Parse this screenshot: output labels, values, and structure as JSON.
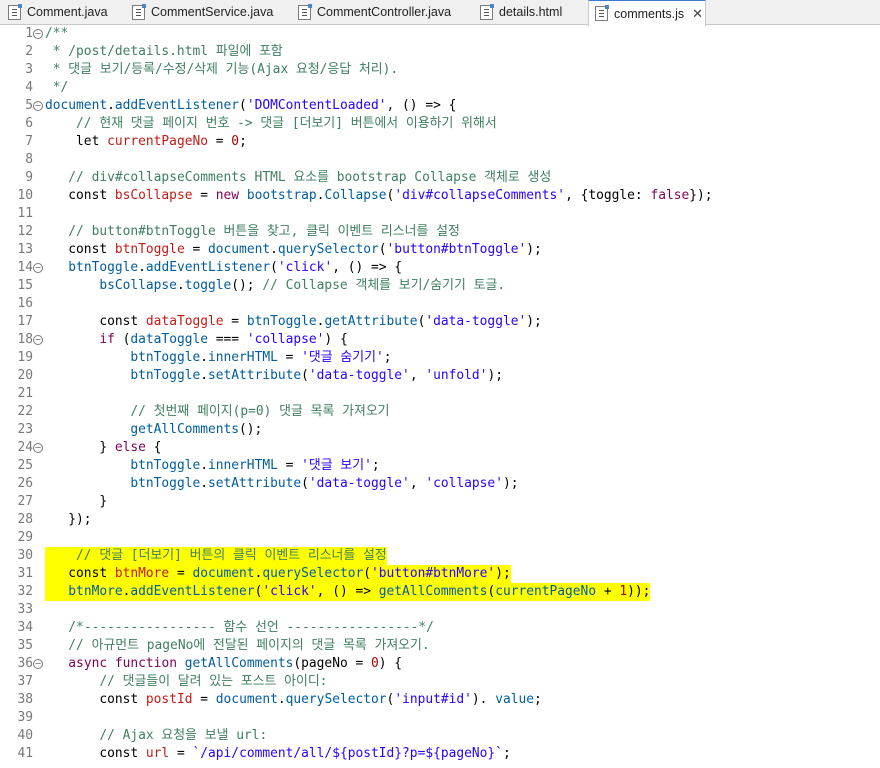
{
  "tabs": [
    {
      "label": "Comment.java",
      "icon": "java-file-icon"
    },
    {
      "label": "CommentService.java",
      "icon": "java-file-icon"
    },
    {
      "label": "CommentController.java",
      "icon": "java-file-icon"
    },
    {
      "label": "details.html",
      "icon": "html-file-icon"
    },
    {
      "label": "comments.js",
      "icon": "js-file-icon",
      "active": true,
      "close": "✕"
    }
  ],
  "colors": {
    "highlight": "#ffff00",
    "comment": "#3f7f5f",
    "string": "#2a00ff",
    "accent": "#3d7acc"
  },
  "lines": [
    {
      "n": "1",
      "fold": true,
      "t": [
        [
          "cm",
          "/**"
        ]
      ]
    },
    {
      "n": "2",
      "t": [
        [
          "cm",
          " * /post/details.html 파일에 포함"
        ]
      ]
    },
    {
      "n": "3",
      "t": [
        [
          "cm",
          " * 댓글 보기/등록/수정/삭제 기능(Ajax 요청/응답 처리)."
        ]
      ]
    },
    {
      "n": "4",
      "t": [
        [
          "cm",
          " */"
        ]
      ]
    },
    {
      "n": "5",
      "fold": true,
      "t": [
        [
          "pr",
          "document"
        ],
        [
          "tx",
          "."
        ],
        [
          "fn",
          "addEventListener"
        ],
        [
          "tx",
          "("
        ],
        [
          "st",
          "'DOMContentLoaded'"
        ],
        [
          "tx",
          ", () => {"
        ]
      ]
    },
    {
      "n": "6",
      "t": [
        [
          "tx",
          "    "
        ],
        [
          "cm",
          "// 현재 댓글 페이지 번호 -> 댓글 [더보기] 버튼에서 이용하기 위해서"
        ]
      ]
    },
    {
      "n": "7",
      "t": [
        [
          "tx",
          "    let "
        ],
        [
          "va",
          "currentPageNo"
        ],
        [
          "tx",
          " = "
        ],
        [
          "num",
          "0"
        ],
        [
          "tx",
          ";"
        ]
      ]
    },
    {
      "n": "8",
      "t": []
    },
    {
      "n": "9",
      "t": [
        [
          "tx",
          "   "
        ],
        [
          "cm",
          "// div#collapseComments HTML 요소를 bootstrap Collapse 객체로 생성"
        ]
      ]
    },
    {
      "n": "10",
      "t": [
        [
          "tx",
          "   const "
        ],
        [
          "va",
          "bsCollapse"
        ],
        [
          "tx",
          " = "
        ],
        [
          "bo",
          "new"
        ],
        [
          "tx",
          " "
        ],
        [
          "pr",
          "bootstrap"
        ],
        [
          "tx",
          "."
        ],
        [
          "fn",
          "Collapse"
        ],
        [
          "tx",
          "("
        ],
        [
          "st",
          "'div#collapseComments'"
        ],
        [
          "tx",
          ", {toggle: "
        ],
        [
          "bo",
          "false"
        ],
        [
          "tx",
          "});"
        ]
      ]
    },
    {
      "n": "11",
      "t": []
    },
    {
      "n": "12",
      "t": [
        [
          "tx",
          "   "
        ],
        [
          "cm",
          "// button#btnToggle 버튼을 찾고, 클릭 이벤트 리스너를 설정"
        ]
      ]
    },
    {
      "n": "13",
      "t": [
        [
          "tx",
          "   const "
        ],
        [
          "va",
          "btnToggle"
        ],
        [
          "tx",
          " = "
        ],
        [
          "pr",
          "document"
        ],
        [
          "tx",
          "."
        ],
        [
          "fn",
          "querySelector"
        ],
        [
          "tx",
          "("
        ],
        [
          "st",
          "'button#btnToggle'"
        ],
        [
          "tx",
          ");"
        ]
      ]
    },
    {
      "n": "14",
      "fold": true,
      "t": [
        [
          "tx",
          "   "
        ],
        [
          "pr",
          "btnToggle"
        ],
        [
          "tx",
          "."
        ],
        [
          "fn",
          "addEventListener"
        ],
        [
          "tx",
          "("
        ],
        [
          "st",
          "'click'"
        ],
        [
          "tx",
          ", () => {"
        ]
      ]
    },
    {
      "n": "15",
      "t": [
        [
          "tx",
          "       "
        ],
        [
          "pr",
          "bsCollapse"
        ],
        [
          "tx",
          "."
        ],
        [
          "fn",
          "toggle"
        ],
        [
          "tx",
          "(); "
        ],
        [
          "cm",
          "// Collapse 객체를 보기/숨기기 토글."
        ]
      ]
    },
    {
      "n": "16",
      "t": []
    },
    {
      "n": "17",
      "t": [
        [
          "tx",
          "       const "
        ],
        [
          "va",
          "dataToggle"
        ],
        [
          "tx",
          " = "
        ],
        [
          "pr",
          "btnToggle"
        ],
        [
          "tx",
          "."
        ],
        [
          "fn",
          "getAttribute"
        ],
        [
          "tx",
          "("
        ],
        [
          "st",
          "'data-toggle'"
        ],
        [
          "tx",
          ");"
        ]
      ]
    },
    {
      "n": "18",
      "fold": true,
      "t": [
        [
          "tx",
          "       "
        ],
        [
          "bo",
          "if"
        ],
        [
          "tx",
          " ("
        ],
        [
          "pr",
          "dataToggle"
        ],
        [
          "tx",
          " === "
        ],
        [
          "st",
          "'collapse'"
        ],
        [
          "tx",
          ") {"
        ]
      ]
    },
    {
      "n": "19",
      "t": [
        [
          "tx",
          "           "
        ],
        [
          "pr",
          "btnToggle"
        ],
        [
          "tx",
          "."
        ],
        [
          "pr",
          "innerHTML"
        ],
        [
          "tx",
          " = "
        ],
        [
          "st",
          "'댓글 숨기기'"
        ],
        [
          "tx",
          ";"
        ]
      ]
    },
    {
      "n": "20",
      "t": [
        [
          "tx",
          "           "
        ],
        [
          "pr",
          "btnToggle"
        ],
        [
          "tx",
          "."
        ],
        [
          "fn",
          "setAttribute"
        ],
        [
          "tx",
          "("
        ],
        [
          "st",
          "'data-toggle'"
        ],
        [
          "tx",
          ", "
        ],
        [
          "st",
          "'unfold'"
        ],
        [
          "tx",
          ");"
        ]
      ]
    },
    {
      "n": "21",
      "t": []
    },
    {
      "n": "22",
      "t": [
        [
          "tx",
          "           "
        ],
        [
          "cm",
          "// 첫번째 페이지(p=0) 댓글 목록 가져오기"
        ]
      ]
    },
    {
      "n": "23",
      "t": [
        [
          "tx",
          "           "
        ],
        [
          "fn",
          "getAllComments"
        ],
        [
          "tx",
          "();"
        ]
      ]
    },
    {
      "n": "24",
      "fold": true,
      "t": [
        [
          "tx",
          "       } "
        ],
        [
          "bo",
          "else"
        ],
        [
          "tx",
          " {"
        ]
      ]
    },
    {
      "n": "25",
      "t": [
        [
          "tx",
          "           "
        ],
        [
          "pr",
          "btnToggle"
        ],
        [
          "tx",
          "."
        ],
        [
          "pr",
          "innerHTML"
        ],
        [
          "tx",
          " = "
        ],
        [
          "st",
          "'댓글 보기'"
        ],
        [
          "tx",
          ";"
        ]
      ]
    },
    {
      "n": "26",
      "t": [
        [
          "tx",
          "           "
        ],
        [
          "pr",
          "btnToggle"
        ],
        [
          "tx",
          "."
        ],
        [
          "fn",
          "setAttribute"
        ],
        [
          "tx",
          "("
        ],
        [
          "st",
          "'data-toggle'"
        ],
        [
          "tx",
          ", "
        ],
        [
          "st",
          "'collapse'"
        ],
        [
          "tx",
          ");"
        ]
      ]
    },
    {
      "n": "27",
      "t": [
        [
          "tx",
          "       }"
        ]
      ]
    },
    {
      "n": "28",
      "t": [
        [
          "tx",
          "   });"
        ]
      ]
    },
    {
      "n": "29",
      "t": []
    },
    {
      "n": "30",
      "hl": true,
      "t": [
        [
          "tx",
          "    "
        ],
        [
          "cm",
          "// 댓글 [더보기] 버튼의 클릭 이벤트 리스너를 설정"
        ]
      ]
    },
    {
      "n": "31",
      "hl": true,
      "t": [
        [
          "tx",
          "   const "
        ],
        [
          "va",
          "btnMore"
        ],
        [
          "tx",
          " = "
        ],
        [
          "pr",
          "document"
        ],
        [
          "tx",
          "."
        ],
        [
          "fn",
          "querySelector"
        ],
        [
          "tx",
          "("
        ],
        [
          "st",
          "'button#btnMore'"
        ],
        [
          "tx",
          ");"
        ]
      ]
    },
    {
      "n": "32",
      "hl": true,
      "t": [
        [
          "tx",
          "   "
        ],
        [
          "pr",
          "btnMore"
        ],
        [
          "tx",
          "."
        ],
        [
          "fn",
          "addEventListener"
        ],
        [
          "tx",
          "("
        ],
        [
          "st",
          "'click'"
        ],
        [
          "tx",
          ", () => "
        ],
        [
          "fn",
          "getAllComments"
        ],
        [
          "tx",
          "("
        ],
        [
          "pr",
          "currentPageNo"
        ],
        [
          "tx",
          " + "
        ],
        [
          "num",
          "1"
        ],
        [
          "tx",
          "));"
        ]
      ]
    },
    {
      "n": "33",
      "t": []
    },
    {
      "n": "34",
      "t": [
        [
          "tx",
          "   "
        ],
        [
          "cm",
          "/*----------------- 함수 선언 -----------------*/"
        ]
      ]
    },
    {
      "n": "35",
      "t": [
        [
          "tx",
          "   "
        ],
        [
          "cm",
          "// 아규먼트 pageNo에 전달된 페이지의 댓글 목록 가져오기."
        ]
      ]
    },
    {
      "n": "36",
      "fold": true,
      "t": [
        [
          "tx",
          "   "
        ],
        [
          "bo",
          "async"
        ],
        [
          "tx",
          " "
        ],
        [
          "bo",
          "function"
        ],
        [
          "tx",
          " "
        ],
        [
          "fn",
          "getAllComments"
        ],
        [
          "tx",
          "(pageNo = "
        ],
        [
          "num",
          "0"
        ],
        [
          "tx",
          ") {"
        ]
      ]
    },
    {
      "n": "37",
      "t": [
        [
          "tx",
          "       "
        ],
        [
          "cm",
          "// 댓글들이 달려 있는 포스트 아이디:"
        ]
      ]
    },
    {
      "n": "38",
      "t": [
        [
          "tx",
          "       const "
        ],
        [
          "va",
          "postId"
        ],
        [
          "tx",
          " = "
        ],
        [
          "pr",
          "document"
        ],
        [
          "tx",
          "."
        ],
        [
          "fn",
          "querySelector"
        ],
        [
          "tx",
          "("
        ],
        [
          "st",
          "'input#id'"
        ],
        [
          "tx",
          "). "
        ],
        [
          "pr",
          "value"
        ],
        [
          "tx",
          ";"
        ]
      ]
    },
    {
      "n": "39",
      "t": []
    },
    {
      "n": "40",
      "t": [
        [
          "tx",
          "       "
        ],
        [
          "cm",
          "// Ajax 요청을 보낼 url:"
        ]
      ]
    },
    {
      "n": "41",
      "t": [
        [
          "tx",
          "       const "
        ],
        [
          "va",
          "url"
        ],
        [
          "tx",
          " = "
        ],
        [
          "st",
          "`/api/comment/all/${postId}?p=${pageNo}`"
        ],
        [
          "tx",
          ";"
        ]
      ]
    }
  ]
}
